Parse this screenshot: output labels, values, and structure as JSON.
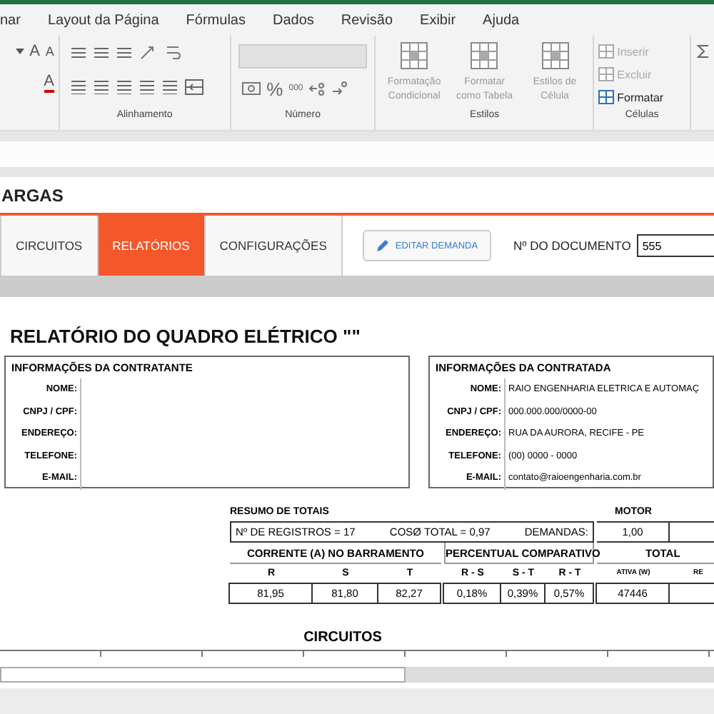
{
  "ribbon_tabs": [
    {
      "label": "nar"
    },
    {
      "label": "Layout da Página"
    },
    {
      "label": "Fórmulas"
    },
    {
      "label": "Dados"
    },
    {
      "label": "Revisão"
    },
    {
      "label": "Exibir"
    },
    {
      "label": "Ajuda"
    }
  ],
  "ribbon_groups": [
    {
      "kind": "font",
      "glyphs": [
        "A",
        "A",
        "A"
      ]
    },
    {
      "kind": "align",
      "label": "Alinhamento"
    },
    {
      "kind": "number",
      "label": "Número",
      "symbols": [
        "%",
        "000"
      ]
    },
    {
      "kind": "styles",
      "label": "Estilos",
      "buttons": [
        {
          "label": "Formatação Condicional",
          "disabled": true
        },
        {
          "label": "Formatar como Tabela",
          "disabled": true
        },
        {
          "label": "Estilos de Célula",
          "disabled": true
        }
      ]
    },
    {
      "kind": "cells",
      "label": "Células",
      "buttons": [
        {
          "label": "Inserir",
          "disabled": true
        },
        {
          "label": "Excluir",
          "disabled": true
        },
        {
          "label": "Formatar",
          "disabled": false
        }
      ]
    }
  ],
  "sheet_title": "ARGAS",
  "nav_tabs": [
    {
      "label": "CIRCUITOS",
      "selected": false
    },
    {
      "label": "RELATÓRIOS",
      "selected": true
    },
    {
      "label": "CONFIGURAÇÕES",
      "selected": false
    }
  ],
  "edit_button": "EDITAR DEMANDA",
  "document": {
    "label": "Nº DO DOCUMENTO",
    "value": "555"
  },
  "report": {
    "title": "RELATÓRIO DO QUADRO ELÉTRICO \"\"",
    "info_boxes": [
      {
        "heading": "INFORMAÇÕES DA CONTRATANTE",
        "fields": [
          {
            "label": "NOME:"
          },
          {
            "label": "CNPJ / CPF:"
          },
          {
            "label": "ENDEREÇO:"
          },
          {
            "label": "TELEFONE:"
          },
          {
            "label": "E-MAIL:"
          }
        ]
      },
      {
        "heading": "INFORMAÇÕES DA CONTRATADA",
        "fields": [
          {
            "label": "NOME:",
            "value": "RAIO ENGENHARIA ELETRICA E AUTOMAÇ"
          },
          {
            "label": "CNPJ / CPF:",
            "value": "000.000.000/0000-00"
          },
          {
            "label": "ENDEREÇO:",
            "value": "RUA DA AURORA, RECIFE - PE"
          },
          {
            "label": "TELEFONE:",
            "value": "(00) 0000 - 0000"
          },
          {
            "label": "E-MAIL:",
            "value": "contato@raioengenharia.com.br"
          }
        ]
      }
    ]
  },
  "summary": {
    "title": "RESUMO DE TOTAIS",
    "motor_label": "MOTOR",
    "registros": "Nº DE REGISTROS = 17",
    "cos": "COSØ TOTAL = 0,97",
    "demandas_label": "DEMANDAS:",
    "demandas_value": "1,00",
    "groups": [
      "CORRENTE (A) NO BARRAMENTO",
      "PERCENTUAL COMPARATIVO",
      "TOTAL"
    ],
    "columns": [
      "R",
      "S",
      "T",
      "R - S",
      "S - T",
      "R - T",
      "ATIVA (W)",
      "RE"
    ],
    "values": [
      "81,95",
      "81,80",
      "82,27",
      "0,18%",
      "0,39%",
      "0,57%",
      "47446"
    ]
  },
  "circuits_heading": "CIRCUITOS"
}
